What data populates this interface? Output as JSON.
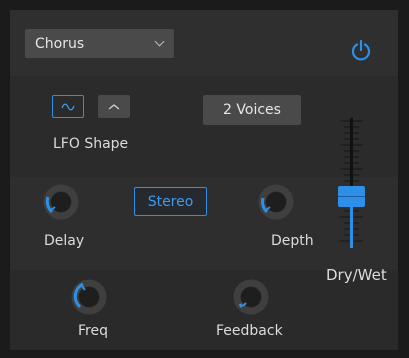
{
  "effect": {
    "selected": "Chorus",
    "power_on": true
  },
  "lfo": {
    "shape_label": "LFO Shape",
    "shapes": [
      "sine-wave-icon",
      "triangle-wave-icon"
    ],
    "selected_shape": "sine"
  },
  "voices": {
    "value": "2 Voices"
  },
  "stereo": {
    "label": "Stereo",
    "active": true
  },
  "knobs": {
    "delay": {
      "label": "Delay",
      "value": 0.25
    },
    "depth": {
      "label": "Depth",
      "value": 0.22
    },
    "freq": {
      "label": "Freq",
      "value": 0.55
    },
    "feedback": {
      "label": "Feedback",
      "value": 0.08
    }
  },
  "drywet": {
    "label": "Dry/Wet",
    "value": 0.4
  },
  "colors": {
    "accent": "#2d8fe6",
    "panel": "#2c2c2c",
    "control": "#4a4a4a"
  }
}
